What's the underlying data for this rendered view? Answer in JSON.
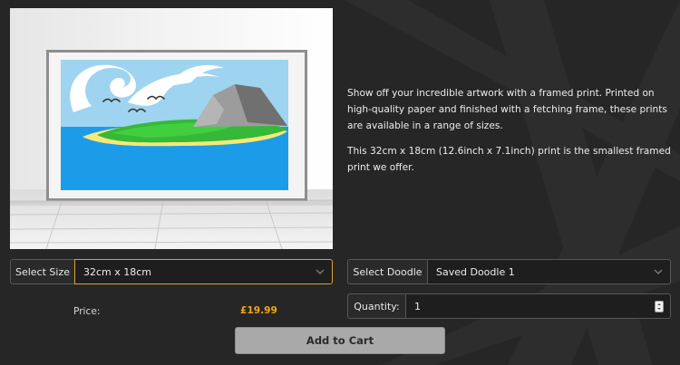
{
  "product": {
    "image_alt": "Framed doodle print leaning against a white wall",
    "description": [
      "Show off your incredible artwork with a framed print. Printed on high-quality paper and finished with a fetching frame, these prints are available in a range of sizes.",
      "This 32cm x 18cm (12.6inch x 7.1inch) print is the smallest framed print we offer."
    ]
  },
  "form": {
    "size_label": "Select Size",
    "size_value": "32cm x 18cm",
    "doodle_label": "Select Doodle",
    "doodle_value": "Saved Doodle 1",
    "quantity_label": "Quantity:",
    "quantity_value": "1",
    "price_label": "Price:",
    "price_value": "£19.99",
    "add_to_cart": "Add to Cart"
  },
  "colors": {
    "background": "#262626",
    "accent": "#f2a516",
    "focus_border": "#d9a132",
    "button": "#a9a9a9"
  },
  "icons": {
    "dropdown": "chevron-down-icon",
    "stepper": "spinner-arrows-icon"
  }
}
